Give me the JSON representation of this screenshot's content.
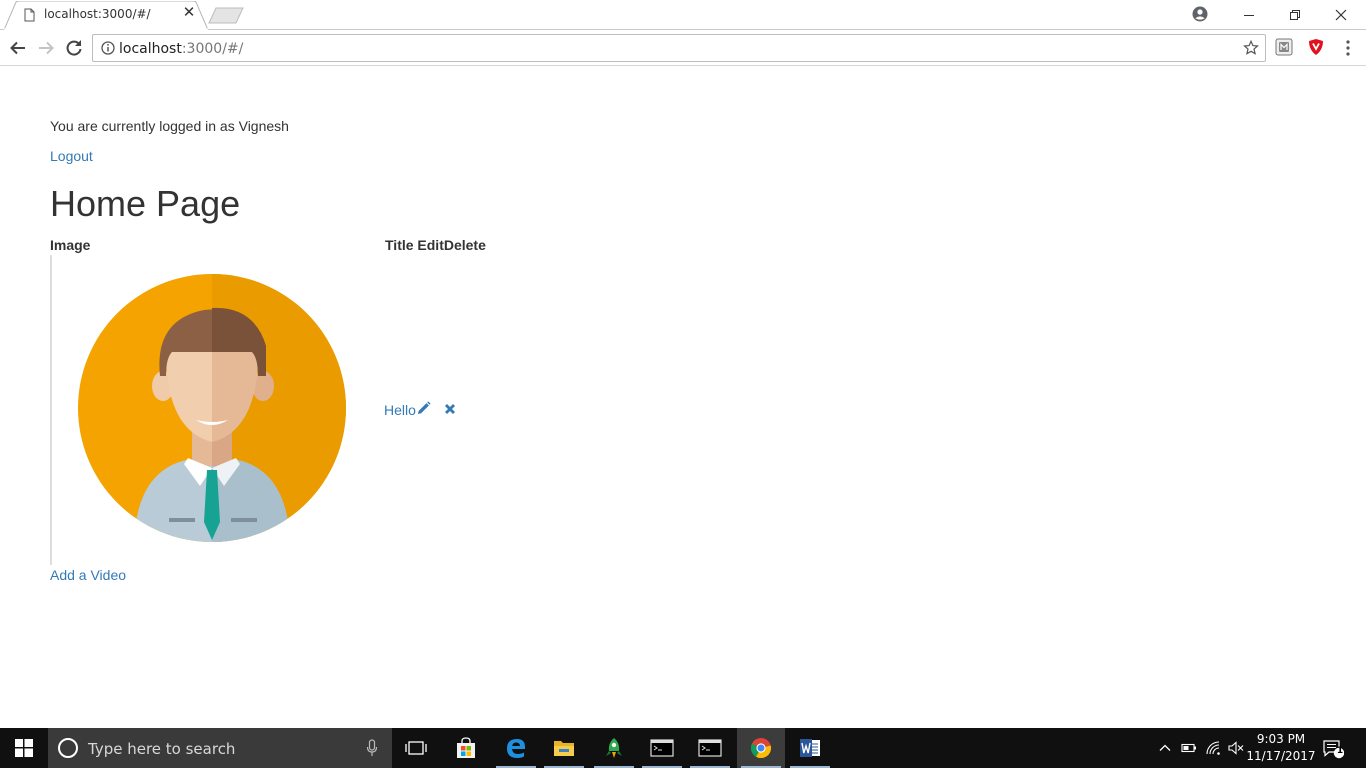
{
  "browser": {
    "tab": {
      "title": "localhost:3000/#/"
    },
    "address": {
      "host": "localhost",
      "path": ":3000/#/"
    }
  },
  "page": {
    "login_message": "You are currently logged in as Vignesh",
    "logout_label": "Logout",
    "title": "Home Page",
    "table": {
      "headers": {
        "image": "Image",
        "title_edit_delete": "Title EditDelete"
      },
      "rows": [
        {
          "title": "Hello",
          "edit_icon": "pencil-icon",
          "delete_icon": "x-icon"
        }
      ]
    },
    "add_video_label": "Add a Video"
  },
  "taskbar": {
    "search_placeholder": "Type here to search",
    "time": "9:03 PM",
    "date": "11/17/2017",
    "notification_count": "1"
  },
  "colors": {
    "link": "#337ab7",
    "taskbar_bg": "#101010",
    "avatar_orange": "#f4a300"
  }
}
